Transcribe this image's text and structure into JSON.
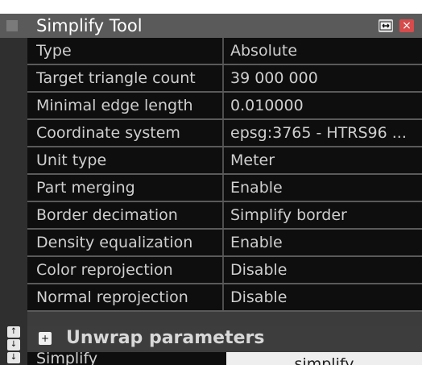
{
  "window": {
    "title": "Simplify Tool",
    "restore_icon": "restore-icon",
    "close_icon": "close-icon",
    "close_glyph": "×"
  },
  "properties": [
    {
      "label": "Type",
      "value": "Absolute"
    },
    {
      "label": "Target triangle count",
      "value": "39 000 000"
    },
    {
      "label": "Minimal edge length",
      "value": "0.010000"
    },
    {
      "label": "Coordinate system",
      "value": "epsg:3765 - HTRS96 ..."
    },
    {
      "label": "Unit type",
      "value": "Meter"
    },
    {
      "label": "Part merging",
      "value": "Enable"
    },
    {
      "label": "Border decimation",
      "value": "Simplify border"
    },
    {
      "label": "Density equalization",
      "value": "Enable"
    },
    {
      "label": "Color reprojection",
      "value": "Disable"
    },
    {
      "label": "Normal reprojection",
      "value": "Disable"
    }
  ],
  "section": {
    "title": "Unwrap parameters",
    "expand_icon": "plus-box-icon",
    "expand_glyph": "+"
  },
  "simplify": {
    "label": "Simplify",
    "button_label": "simplify"
  },
  "rail": {
    "icons": [
      "up-arrow-box-icon",
      "down-arrow-box-icon",
      "down-arrow-box-icon"
    ],
    "glyphs": [
      "↑",
      "↓",
      "↓"
    ]
  },
  "colors": {
    "panel_bg": "#3c3c3c",
    "row_bg": "#0e0e0e",
    "title_bg": "#5a5a5a",
    "close_red": "#d64b4b"
  }
}
